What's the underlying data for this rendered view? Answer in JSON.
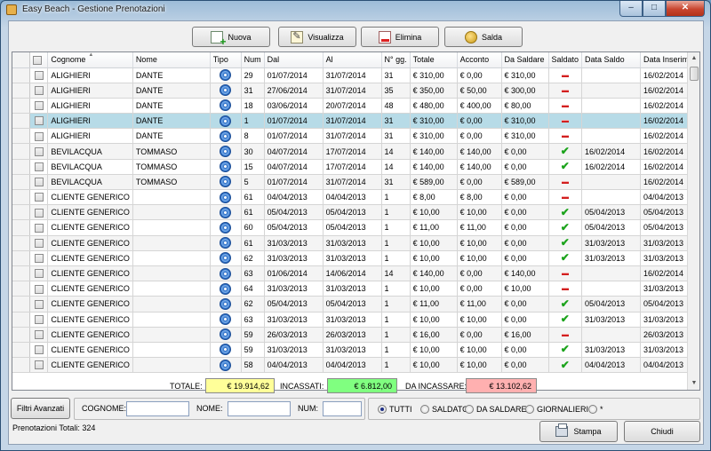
{
  "window": {
    "title": "Easy Beach - Gestione Prenotazioni"
  },
  "window_controls": {
    "minimize": "‒",
    "maximize": "□",
    "close": "✕"
  },
  "toolbar": {
    "nuova": "Nuova",
    "visualizza": "Visualizza",
    "elimina": "Elimina",
    "salda": "Salda"
  },
  "columns": [
    "",
    "Cognome",
    "Nome",
    "Tipo",
    "Num",
    "Dal",
    "Al",
    "N° gg.",
    "Totale",
    "Acconto",
    "Da Saldare",
    "Saldato",
    "Data Saldo",
    "Data Inserim."
  ],
  "rows": [
    {
      "cognome": "ALIGHIERI",
      "nome": "DANTE",
      "num": "29",
      "dal": "01/07/2014",
      "al": "31/07/2014",
      "gg": "31",
      "totale": "€ 310,00",
      "acconto": "€ 0,00",
      "da_saldare": "€ 310,00",
      "saldato": false,
      "data_saldo": "",
      "data_inserim": "16/02/2014"
    },
    {
      "cognome": "ALIGHIERI",
      "nome": "DANTE",
      "num": "31",
      "dal": "27/06/2014",
      "al": "31/07/2014",
      "gg": "35",
      "totale": "€ 350,00",
      "acconto": "€ 50,00",
      "da_saldare": "€ 300,00",
      "saldato": false,
      "data_saldo": "",
      "data_inserim": "16/02/2014"
    },
    {
      "cognome": "ALIGHIERI",
      "nome": "DANTE",
      "num": "18",
      "dal": "03/06/2014",
      "al": "20/07/2014",
      "gg": "48",
      "totale": "€ 480,00",
      "acconto": "€ 400,00",
      "da_saldare": "€ 80,00",
      "saldato": false,
      "data_saldo": "",
      "data_inserim": "16/02/2014"
    },
    {
      "cognome": "ALIGHIERI",
      "nome": "DANTE",
      "num": "1",
      "dal": "01/07/2014",
      "al": "31/07/2014",
      "gg": "31",
      "totale": "€ 310,00",
      "acconto": "€ 0,00",
      "da_saldare": "€ 310,00",
      "saldato": false,
      "data_saldo": "",
      "data_inserim": "16/02/2014",
      "selected": true
    },
    {
      "cognome": "ALIGHIERI",
      "nome": "DANTE",
      "num": "8",
      "dal": "01/07/2014",
      "al": "31/07/2014",
      "gg": "31",
      "totale": "€ 310,00",
      "acconto": "€ 0,00",
      "da_saldare": "€ 310,00",
      "saldato": false,
      "data_saldo": "",
      "data_inserim": "16/02/2014"
    },
    {
      "cognome": "BEVILACQUA",
      "nome": "TOMMASO",
      "num": "30",
      "dal": "04/07/2014",
      "al": "17/07/2014",
      "gg": "14",
      "totale": "€ 140,00",
      "acconto": "€ 140,00",
      "da_saldare": "€ 0,00",
      "saldato": true,
      "data_saldo": "16/02/2014",
      "data_inserim": "16/02/2014"
    },
    {
      "cognome": "BEVILACQUA",
      "nome": "TOMMASO",
      "num": "15",
      "dal": "04/07/2014",
      "al": "17/07/2014",
      "gg": "14",
      "totale": "€ 140,00",
      "acconto": "€ 140,00",
      "da_saldare": "€ 0,00",
      "saldato": true,
      "data_saldo": "16/02/2014",
      "data_inserim": "16/02/2014"
    },
    {
      "cognome": "BEVILACQUA",
      "nome": "TOMMASO",
      "num": "5",
      "dal": "01/07/2014",
      "al": "31/07/2014",
      "gg": "31",
      "totale": "€ 589,00",
      "acconto": "€ 0,00",
      "da_saldare": "€ 589,00",
      "saldato": false,
      "data_saldo": "",
      "data_inserim": "16/02/2014"
    },
    {
      "cognome": "CLIENTE GENERICO",
      "nome": "",
      "num": "61",
      "dal": "04/04/2013",
      "al": "04/04/2013",
      "gg": "1",
      "totale": "€ 8,00",
      "acconto": "€ 8,00",
      "da_saldare": "€ 0,00",
      "saldato": false,
      "data_saldo": "",
      "data_inserim": "04/04/2013"
    },
    {
      "cognome": "CLIENTE GENERICO",
      "nome": "",
      "num": "61",
      "dal": "05/04/2013",
      "al": "05/04/2013",
      "gg": "1",
      "totale": "€ 10,00",
      "acconto": "€ 10,00",
      "da_saldare": "€ 0,00",
      "saldato": true,
      "data_saldo": "05/04/2013",
      "data_inserim": "05/04/2013"
    },
    {
      "cognome": "CLIENTE GENERICO",
      "nome": "",
      "num": "60",
      "dal": "05/04/2013",
      "al": "05/04/2013",
      "gg": "1",
      "totale": "€ 11,00",
      "acconto": "€ 11,00",
      "da_saldare": "€ 0,00",
      "saldato": true,
      "data_saldo": "05/04/2013",
      "data_inserim": "05/04/2013"
    },
    {
      "cognome": "CLIENTE GENERICO",
      "nome": "",
      "num": "61",
      "dal": "31/03/2013",
      "al": "31/03/2013",
      "gg": "1",
      "totale": "€ 10,00",
      "acconto": "€ 10,00",
      "da_saldare": "€ 0,00",
      "saldato": true,
      "data_saldo": "31/03/2013",
      "data_inserim": "31/03/2013"
    },
    {
      "cognome": "CLIENTE GENERICO",
      "nome": "",
      "num": "62",
      "dal": "31/03/2013",
      "al": "31/03/2013",
      "gg": "1",
      "totale": "€ 10,00",
      "acconto": "€ 10,00",
      "da_saldare": "€ 0,00",
      "saldato": true,
      "data_saldo": "31/03/2013",
      "data_inserim": "31/03/2013"
    },
    {
      "cognome": "CLIENTE GENERICO",
      "nome": "",
      "num": "63",
      "dal": "01/06/2014",
      "al": "14/06/2014",
      "gg": "14",
      "totale": "€ 140,00",
      "acconto": "€ 0,00",
      "da_saldare": "€ 140,00",
      "saldato": false,
      "data_saldo": "",
      "data_inserim": "16/02/2014"
    },
    {
      "cognome": "CLIENTE GENERICO",
      "nome": "",
      "num": "64",
      "dal": "31/03/2013",
      "al": "31/03/2013",
      "gg": "1",
      "totale": "€ 10,00",
      "acconto": "€ 0,00",
      "da_saldare": "€ 10,00",
      "saldato": false,
      "data_saldo": "",
      "data_inserim": "31/03/2013"
    },
    {
      "cognome": "CLIENTE GENERICO",
      "nome": "",
      "num": "62",
      "dal": "05/04/2013",
      "al": "05/04/2013",
      "gg": "1",
      "totale": "€ 11,00",
      "acconto": "€ 11,00",
      "da_saldare": "€ 0,00",
      "saldato": true,
      "data_saldo": "05/04/2013",
      "data_inserim": "05/04/2013"
    },
    {
      "cognome": "CLIENTE GENERICO",
      "nome": "",
      "num": "63",
      "dal": "31/03/2013",
      "al": "31/03/2013",
      "gg": "1",
      "totale": "€ 10,00",
      "acconto": "€ 10,00",
      "da_saldare": "€ 0,00",
      "saldato": true,
      "data_saldo": "31/03/2013",
      "data_inserim": "31/03/2013"
    },
    {
      "cognome": "CLIENTE GENERICO",
      "nome": "",
      "num": "59",
      "dal": "26/03/2013",
      "al": "26/03/2013",
      "gg": "1",
      "totale": "€ 16,00",
      "acconto": "€ 0,00",
      "da_saldare": "€ 16,00",
      "saldato": false,
      "data_saldo": "",
      "data_inserim": "26/03/2013"
    },
    {
      "cognome": "CLIENTE GENERICO",
      "nome": "",
      "num": "59",
      "dal": "31/03/2013",
      "al": "31/03/2013",
      "gg": "1",
      "totale": "€ 10,00",
      "acconto": "€ 10,00",
      "da_saldare": "€ 0,00",
      "saldato": true,
      "data_saldo": "31/03/2013",
      "data_inserim": "31/03/2013"
    },
    {
      "cognome": "CLIENTE GENERICO",
      "nome": "",
      "num": "58",
      "dal": "04/04/2013",
      "al": "04/04/2013",
      "gg": "1",
      "totale": "€ 10,00",
      "acconto": "€ 10,00",
      "da_saldare": "€ 0,00",
      "saldato": true,
      "data_saldo": "04/04/2013",
      "data_inserim": "04/04/2013"
    }
  ],
  "totals": {
    "totale_label": "TOTALE:",
    "totale_value": "€ 19.914,62",
    "incassati_label": "INCASSATI:",
    "incassati_value": "€ 6.812,00",
    "da_incassare_label": "DA INCASSARE:",
    "da_incassare_value": "€ 13.102,62",
    "colors": {
      "totale": "#ffff99",
      "incassati": "#80ff80",
      "da_incassare": "#ffb0b0"
    }
  },
  "filters": {
    "advanced_button": "Filtri Avanzati",
    "cognome_label": "COGNOME:",
    "nome_label": "NOME:",
    "num_label": "NUM:",
    "cognome_value": "",
    "nome_value": "",
    "num_value": "",
    "radio_options": [
      "TUTTI",
      "SALDATO",
      "DA SALDARE",
      "GIORNALIERI",
      "*"
    ],
    "radio_selected": "TUTTI"
  },
  "footer": {
    "count_text": "Prenotazioni Totali: 324",
    "stampa": "Stampa",
    "chiudi": "Chiudi"
  }
}
